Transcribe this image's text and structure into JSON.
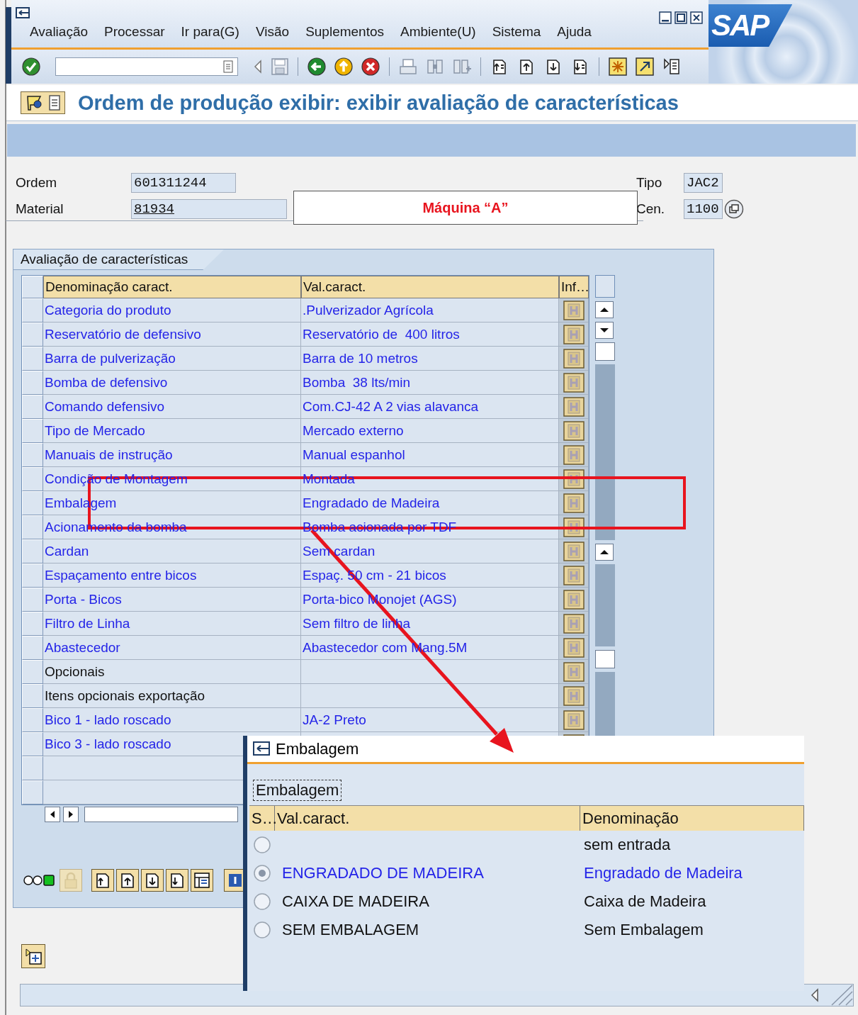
{
  "window": {
    "logo": "SAP",
    "menu": [
      "Avaliação",
      "Processar",
      "Ir para(G)",
      "Visão",
      "Suplementos",
      "Ambiente(U)",
      "Sistema",
      "Ajuda"
    ]
  },
  "screen": {
    "title": "Ordem de produção exibir: exibir avaliação de características"
  },
  "header": {
    "callout": "Máquina “A”",
    "fields": [
      {
        "label": "Ordem",
        "value": "601311244",
        "kind": "text"
      },
      {
        "label": "Material",
        "value": "81934",
        "kind": "link"
      },
      {
        "label": "Tipo",
        "value": "JAC2",
        "kind": "text"
      },
      {
        "label": "Cen.",
        "value": "1100",
        "kind": "text"
      }
    ]
  },
  "characteristics": {
    "title": "Avaliação de características",
    "columns": [
      "Denominação caract.",
      "Val.caract.",
      "Inf…"
    ],
    "rows": [
      {
        "name": "Categoria do produto",
        "value": ".Pulverizador Agrícola",
        "kind": "link"
      },
      {
        "name": "Reservatório de defensivo",
        "value": "Reservatório de  400 litros",
        "kind": "link"
      },
      {
        "name": "Barra de pulverização",
        "value": "Barra de 10 metros",
        "kind": "link"
      },
      {
        "name": "Bomba de defensivo",
        "value": "Bomba  38 lts/min",
        "kind": "link"
      },
      {
        "name": "Comando defensivo",
        "value": "Com.CJ-42 A 2 vias alavanca",
        "kind": "link"
      },
      {
        "name": "Tipo de Mercado",
        "value": "Mercado externo",
        "kind": "link"
      },
      {
        "name": "Manuais de instrução",
        "value": "Manual espanhol",
        "kind": "link"
      },
      {
        "name": "Condição de Montagem",
        "value": "Montada",
        "kind": "link"
      },
      {
        "name": "Embalagem",
        "value": "Engradado de Madeira",
        "kind": "link"
      },
      {
        "name": "Acionamento da bomba",
        "value": "Bomba acionada por TDF",
        "kind": "link"
      },
      {
        "name": "Cardan",
        "value": "Sem cardan",
        "kind": "link"
      },
      {
        "name": "Espaçamento entre bicos",
        "value": "Espaç. 50 cm - 21 bicos",
        "kind": "link"
      },
      {
        "name": "Porta - Bicos",
        "value": "Porta-bico Monojet (AGS)",
        "kind": "link"
      },
      {
        "name": "Filtro de Linha",
        "value": "Sem filtro de linha",
        "kind": "link"
      },
      {
        "name": "Abastecedor",
        "value": "Abastecedor com Mang.5M",
        "kind": "link"
      },
      {
        "name": "Opcionais",
        "kind": "plain"
      },
      {
        "name": "Itens opcionais exportação",
        "kind": "plain"
      },
      {
        "name": "Bico 1 - lado roscado",
        "value": "JA-2 Preto",
        "kind": "link"
      },
      {
        "name": "Bico 3 - lado roscado",
        "kind": "link"
      }
    ]
  },
  "popup": {
    "title": "Embalagem",
    "label": "Embalagem",
    "columns": [
      "S…",
      "Val.caract.",
      "Denominação"
    ],
    "options": [
      {
        "name": "sem entrada",
        "selected": false
      },
      {
        "value": "ENGRADADO DE MADEIRA",
        "name": "Engradado de Madeira",
        "selected": true
      },
      {
        "value": "CAIXA DE MADEIRA",
        "name": "Caixa de Madeira",
        "selected": false
      },
      {
        "value": "SEM EMBALAGEM",
        "name": "Sem Embalagem",
        "selected": false
      }
    ]
  }
}
